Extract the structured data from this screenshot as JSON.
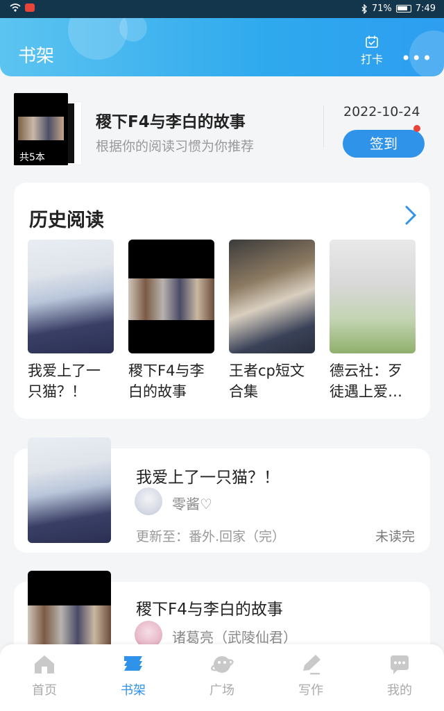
{
  "status_bar": {
    "battery": "71%",
    "time": "7:49"
  },
  "header": {
    "title": "书架",
    "checkin_label": "打卡",
    "more": "•••"
  },
  "recommendation": {
    "cover_count": "共5本",
    "title": "稷下F4与李白的故事",
    "subtitle": "根据你的阅读习惯为你推荐",
    "date": "2022-10-24",
    "sign_label": "签到"
  },
  "history": {
    "title": "历史阅读",
    "books": [
      {
        "name": "我爱上了一只猫？！"
      },
      {
        "name": "稷下F4与李白的故事"
      },
      {
        "name": "王者cp短文合集"
      },
      {
        "name": "德云社：歹徒遇上爱…"
      }
    ]
  },
  "shelf": [
    {
      "title": "我爱上了一只猫？！",
      "author": "零酱♡",
      "update": "更新至：番外.回家（完）",
      "status": "未读完"
    },
    {
      "title": "稷下F4与李白的故事",
      "author": "诸葛亮（武陵仙君）"
    }
  ],
  "bottom_nav": [
    {
      "label": "首页",
      "icon": "home-icon"
    },
    {
      "label": "书架",
      "icon": "bookshelf-icon",
      "active": true
    },
    {
      "label": "广场",
      "icon": "planet-icon"
    },
    {
      "label": "写作",
      "icon": "pen-icon"
    },
    {
      "label": "我的",
      "icon": "chat-bubble-icon"
    }
  ],
  "colors": {
    "accent": "#2f93ea",
    "header_start": "#5cc4f0",
    "header_end": "#2d9ef0",
    "badge": "#e8433a"
  }
}
